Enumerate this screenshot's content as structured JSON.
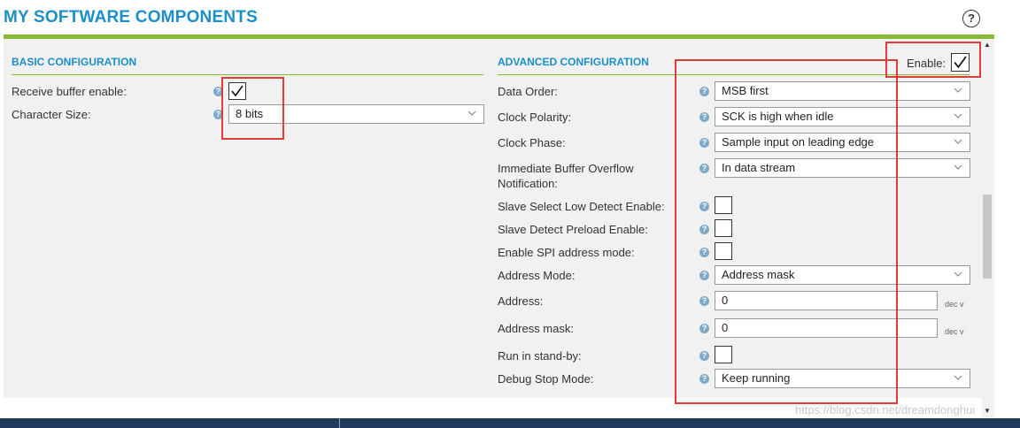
{
  "header": {
    "title": "MY SOFTWARE COMPONENTS",
    "help_symbol": "?"
  },
  "basic": {
    "title": "BASIC CONFIGURATION",
    "receive_buffer_label": "Receive buffer enable:",
    "receive_buffer_checked": true,
    "character_size_label": "Character Size:",
    "character_size_value": "8 bits"
  },
  "advanced": {
    "title": "ADVANCED CONFIGURATION",
    "enable_label": "Enable:",
    "enable_checked": true,
    "data_order_label": "Data Order:",
    "data_order_value": "MSB first",
    "clock_polarity_label": "Clock Polarity:",
    "clock_polarity_value": "SCK is high when idle",
    "clock_phase_label": "Clock Phase:",
    "clock_phase_value": "Sample input on leading edge",
    "overflow_label_line1": "Immediate Buffer Overflow",
    "overflow_label_line2": "Notification:",
    "overflow_value": "In data stream",
    "slave_low_detect_label": "Slave Select Low Detect Enable:",
    "slave_preload_label": "Slave Detect Preload Enable:",
    "spi_address_mode_label": "Enable SPI address mode:",
    "address_mode_label": "Address Mode:",
    "address_mode_value": "Address mask",
    "address_label": "Address:",
    "address_value": "0",
    "address_unit": "dec v",
    "address_mask_label": "Address mask:",
    "address_mask_value": "0",
    "address_mask_unit": "dec v",
    "run_standby_label": "Run in stand-by:",
    "debug_stop_label": "Debug Stop Mode:",
    "debug_stop_value": "Keep running"
  },
  "help_icon_glyph": "?",
  "watermark": "https://blog.csdn.net/dreamdonghui",
  "colors": {
    "accent": "#1a8fc9",
    "green_rule": "#86b935",
    "highlight": "#e03b3b",
    "footer": "#1f3a5c"
  }
}
